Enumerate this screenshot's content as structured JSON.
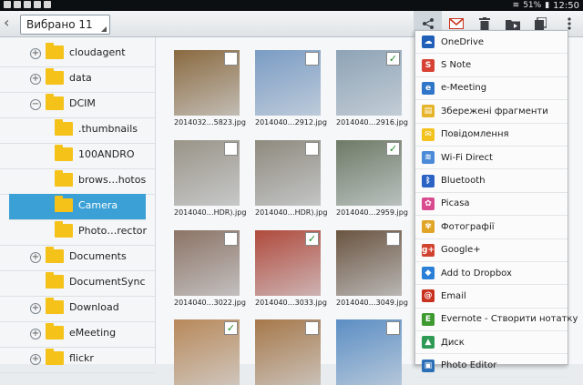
{
  "status": {
    "battery": "51%",
    "time": "12:50"
  },
  "header": {
    "selection": "Вибрано 11"
  },
  "sidebar": {
    "folders": [
      {
        "name": "cloudagent",
        "expander": "+"
      },
      {
        "name": "data",
        "expander": "+"
      },
      {
        "name": "DCIM",
        "expander": "−"
      },
      {
        "name": ".thumbnails",
        "expander": ""
      },
      {
        "name": "100ANDRO",
        "expander": ""
      },
      {
        "name": "brows…hotos",
        "expander": ""
      },
      {
        "name": "Camera",
        "expander": ""
      },
      {
        "name": "Photo…rector",
        "expander": ""
      },
      {
        "name": "Documents",
        "expander": "+"
      },
      {
        "name": "DocumentSync",
        "expander": ""
      },
      {
        "name": "Download",
        "expander": "+"
      },
      {
        "name": "eMeeting",
        "expander": "+"
      },
      {
        "name": "flickr",
        "expander": "+"
      }
    ]
  },
  "files": [
    {
      "name": "2014032…5823.jpg",
      "checked": false,
      "color": "#8a6a40"
    },
    {
      "name": "2014040…2912.jpg",
      "checked": false,
      "color": "#7a9cc4"
    },
    {
      "name": "2014040…2916.jpg",
      "checked": true,
      "color": "#8da3b6"
    },
    {
      "name": "2014040…HDR).jpg",
      "checked": false,
      "color": "#9a9488"
    },
    {
      "name": "2014040…HDR).jpg",
      "checked": false,
      "color": "#8f8a7e"
    },
    {
      "name": "2014040…2959.jpg",
      "checked": true,
      "color": "#6e7a66"
    },
    {
      "name": "2014040…3022.jpg",
      "checked": false,
      "color": "#8c7466"
    },
    {
      "name": "2014040…3033.jpg",
      "checked": true,
      "color": "#b04a3c"
    },
    {
      "name": "2014040…3049.jpg",
      "checked": false,
      "color": "#6a5440"
    },
    {
      "name": "",
      "checked": true,
      "color": "#b8895a"
    },
    {
      "name": "",
      "checked": false,
      "color": "#a6784a"
    },
    {
      "name": "",
      "checked": false,
      "color": "#5b8ec4"
    }
  ],
  "share_menu": [
    {
      "label": "OneDrive",
      "icon": "cloud-icon",
      "color": "#1f5fb8",
      "glyph": "☁"
    },
    {
      "label": "S Note",
      "icon": "snote-icon",
      "color": "#d64233",
      "glyph": "S"
    },
    {
      "label": "e-Meeting",
      "icon": "meeting-icon",
      "color": "#2f76c8",
      "glyph": "e"
    },
    {
      "label": "Збережені фрагменти",
      "icon": "scrapbook-icon",
      "color": "#e6b42a",
      "glyph": "▤"
    },
    {
      "label": "Повідомлення",
      "icon": "message-icon",
      "color": "#f3c21c",
      "glyph": "✉"
    },
    {
      "label": "Wi-Fi Direct",
      "icon": "wifi-direct-icon",
      "color": "#4a8ad6",
      "glyph": "≋"
    },
    {
      "label": "Bluetooth",
      "icon": "bluetooth-icon",
      "color": "#2a63c4",
      "glyph": "ᛒ"
    },
    {
      "label": "Picasa",
      "icon": "picasa-icon",
      "color": "#d84b8e",
      "glyph": "✿"
    },
    {
      "label": "Фотографії",
      "icon": "photos-icon",
      "color": "#e0a526",
      "glyph": "✾"
    },
    {
      "label": "Google+",
      "icon": "google-plus-icon",
      "color": "#d2432f",
      "glyph": "g+"
    },
    {
      "label": "Add to Dropbox",
      "icon": "dropbox-icon",
      "color": "#2a7fd6",
      "glyph": "◆"
    },
    {
      "label": "Email",
      "icon": "email-icon",
      "color": "#c9311f",
      "glyph": "@"
    },
    {
      "label": "Evernote - Створити нотатку",
      "icon": "evernote-icon",
      "color": "#3c9a2e",
      "glyph": "E"
    },
    {
      "label": "Диск",
      "icon": "drive-icon",
      "color": "#2e9a55",
      "glyph": "▲"
    },
    {
      "label": "Photo Editor",
      "icon": "photo-editor-icon",
      "color": "#2b6fb6",
      "glyph": "▣"
    }
  ]
}
